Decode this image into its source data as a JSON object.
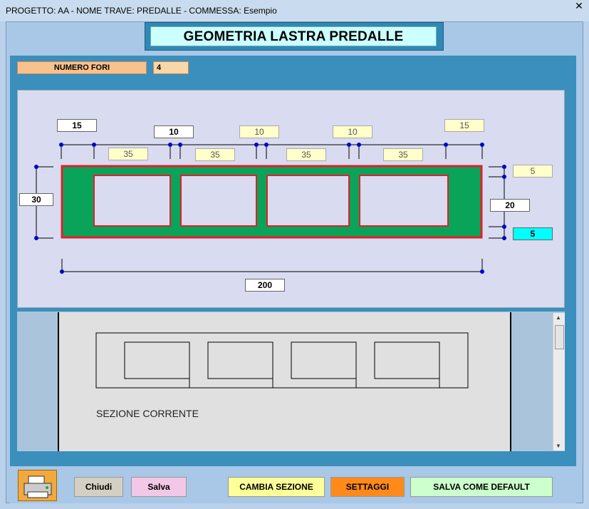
{
  "window": {
    "title": "PROGETTO: AA - NOME TRAVE: PREDALLE - COMMESSA: Esempio",
    "close": "✕"
  },
  "header": {
    "title": "GEOMETRIA LASTRA PREDALLE"
  },
  "numero_fori": {
    "label": "NUMERO FORI",
    "value": "4"
  },
  "dims": {
    "top_left": "15",
    "top_sp1": "10",
    "top_sp2": "10",
    "top_sp3": "10",
    "top_right": "15",
    "hole1": "35",
    "hole2": "35",
    "hole3": "35",
    "hole4": "35",
    "height": "30",
    "right_top": "5",
    "right_mid": "20",
    "right_bot": "5",
    "width": "200"
  },
  "section": {
    "label": "SEZIONE CORRENTE"
  },
  "buttons": {
    "chiudi": "Chiudi",
    "salva": "Salva",
    "cambia": "CAMBIA SEZIONE",
    "settaggi": "SETTAGGI",
    "default": "SALVA COME DEFAULT"
  },
  "icons": {
    "printer": "printer-icon"
  },
  "colors": {
    "slab": "#0aa35a",
    "outline": "#e0202a",
    "dim": "#0000cc"
  }
}
